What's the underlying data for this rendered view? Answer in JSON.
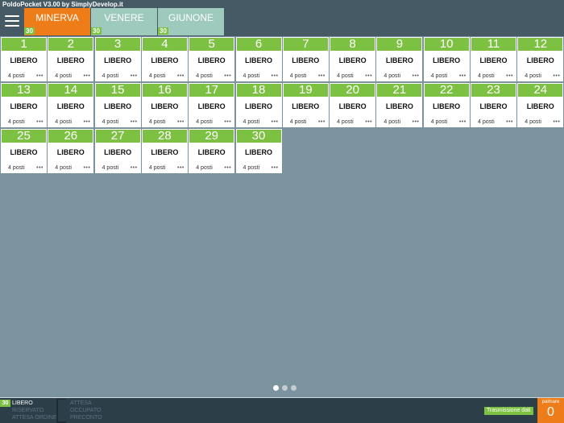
{
  "app": {
    "title": "PoldoPocket V3.00 by SimplyDevelop.it"
  },
  "colors": {
    "free": "#7dc142",
    "active_tab": "#ee7d19",
    "inactive_tab": "#9ec9bd",
    "header": "#465a66",
    "background": "#7a939f"
  },
  "rooms": [
    {
      "name": "MINERVA",
      "count": "30",
      "active": true
    },
    {
      "name": "VENERE",
      "count": "30",
      "active": false
    },
    {
      "name": "GIUNONE",
      "count": "30",
      "active": false
    }
  ],
  "tables": [
    {
      "number": "1",
      "status": "LIBERO",
      "seats": "4 posti"
    },
    {
      "number": "2",
      "status": "LIBERO",
      "seats": "4 posti"
    },
    {
      "number": "3",
      "status": "LIBERO",
      "seats": "4 posti"
    },
    {
      "number": "4",
      "status": "LIBERO",
      "seats": "4 posti"
    },
    {
      "number": "5",
      "status": "LIBERO",
      "seats": "4 posti"
    },
    {
      "number": "6",
      "status": "LIBERO",
      "seats": "4 posti"
    },
    {
      "number": "7",
      "status": "LIBERO",
      "seats": "4 posti"
    },
    {
      "number": "8",
      "status": "LIBERO",
      "seats": "4 posti"
    },
    {
      "number": "9",
      "status": "LIBERO",
      "seats": "4 posti"
    },
    {
      "number": "10",
      "status": "LIBERO",
      "seats": "4 posti"
    },
    {
      "number": "11",
      "status": "LIBERO",
      "seats": "4 posti"
    },
    {
      "number": "12",
      "status": "LIBERO",
      "seats": "4 posti"
    },
    {
      "number": "13",
      "status": "LIBERO",
      "seats": "4 posti"
    },
    {
      "number": "14",
      "status": "LIBERO",
      "seats": "4 posti"
    },
    {
      "number": "15",
      "status": "LIBERO",
      "seats": "4 posti"
    },
    {
      "number": "16",
      "status": "LIBERO",
      "seats": "4 posti"
    },
    {
      "number": "17",
      "status": "LIBERO",
      "seats": "4 posti"
    },
    {
      "number": "18",
      "status": "LIBERO",
      "seats": "4 posti"
    },
    {
      "number": "19",
      "status": "LIBERO",
      "seats": "4 posti"
    },
    {
      "number": "20",
      "status": "LIBERO",
      "seats": "4 posti"
    },
    {
      "number": "21",
      "status": "LIBERO",
      "seats": "4 posti"
    },
    {
      "number": "22",
      "status": "LIBERO",
      "seats": "4 posti"
    },
    {
      "number": "23",
      "status": "LIBERO",
      "seats": "4 posti"
    },
    {
      "number": "24",
      "status": "LIBERO",
      "seats": "4 posti"
    },
    {
      "number": "25",
      "status": "LIBERO",
      "seats": "4 posti"
    },
    {
      "number": "26",
      "status": "LIBERO",
      "seats": "4 posti"
    },
    {
      "number": "27",
      "status": "LIBERO",
      "seats": "4 posti"
    },
    {
      "number": "28",
      "status": "LIBERO",
      "seats": "4 posti"
    },
    {
      "number": "29",
      "status": "LIBERO",
      "seats": "4 posti"
    },
    {
      "number": "30",
      "status": "LIBERO",
      "seats": "4 posti"
    }
  ],
  "more_glyph": "•••",
  "pager": {
    "pages": 3,
    "current": 1
  },
  "legend": {
    "col1": [
      {
        "count": "30",
        "label": "LIBERO",
        "swatch": "#7dc142",
        "text_color": "#ffffff"
      },
      {
        "count": "",
        "label": "RISERVATO",
        "swatch": "#2c3e48",
        "text_color": "#5d7480"
      },
      {
        "count": "",
        "label": "ATTESA ORDINE",
        "swatch": "#2c3e48",
        "text_color": "#5d7480"
      }
    ],
    "col2": [
      {
        "count": "",
        "label": "ATTESA",
        "swatch": "#2c3e48",
        "text_color": "#5d7480"
      },
      {
        "count": "",
        "label": "OCCUPATO",
        "swatch": "#2c3e48",
        "text_color": "#5d7480"
      },
      {
        "count": "",
        "label": "PRECONTO",
        "swatch": "#2c3e48",
        "text_color": "#5d7480"
      }
    ]
  },
  "status_bar": {
    "transmission": "Trasmissione dati",
    "palmare_label": "palmare",
    "palmare_count": "0"
  }
}
